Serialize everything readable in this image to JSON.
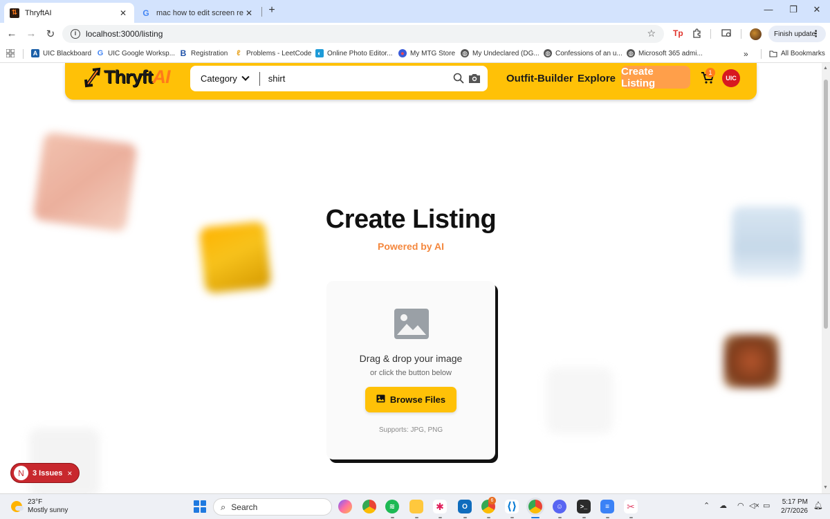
{
  "browser": {
    "tabs": [
      {
        "title": "ThryftAI",
        "active": true
      },
      {
        "title": "mac how to edit screen recordin",
        "active": false
      }
    ],
    "new_tab": "+",
    "url": "localhost:3000/listing",
    "finish_update": "Finish update",
    "bookmarks": [
      "UIC Blackboard",
      "UIC Google Worksp...",
      "Registration",
      "Problems - LeetCode",
      "Online Photo Editor...",
      "My MTG Store",
      "My Undeclared (DG...",
      "Confessions of an u...",
      "Microsoft 365 admi..."
    ],
    "bookmarks_overflow": "»",
    "all_bookmarks": "All Bookmarks"
  },
  "navbar": {
    "logo_main": "Thryft",
    "logo_ai": "AI",
    "category_label": "Category",
    "search_value": "shirt",
    "links": [
      "Outfit-Builder",
      "Explore"
    ],
    "create_listing": "Create Listing",
    "cart_count": "1",
    "avatar_text": "UIC"
  },
  "main": {
    "title": "Create Listing",
    "subtitle": "Powered by AI",
    "upload": {
      "drag_text": "Drag & drop your image",
      "click_text": "or click the button below",
      "browse_label": "Browse Files",
      "supports": "Supports: JPG, PNG"
    }
  },
  "dev_overlay": {
    "logo": "N",
    "issues_label": "3 Issues",
    "close": "×"
  },
  "taskbar": {
    "temperature": "23°F",
    "condition": "Mostly sunny",
    "search_label": "Search",
    "notification_badge": "6",
    "time": "5:17 PM",
    "date": "2/7/2026"
  },
  "colors": {
    "brand_yellow": "#ffc107",
    "accent_orange": "#f4873d",
    "create_btn": "#ff9f4a",
    "issues_red": "#c8282e"
  }
}
